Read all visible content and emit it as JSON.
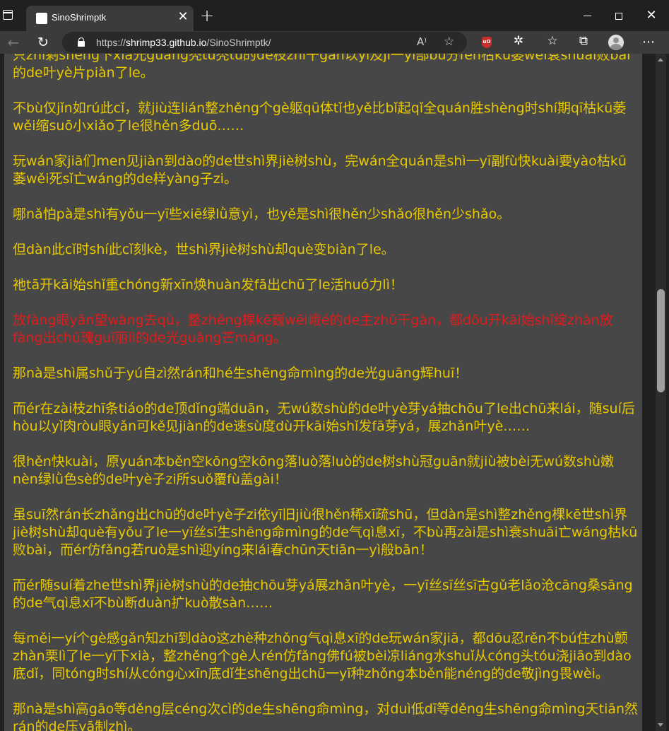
{
  "window": {
    "tab_title": "SinoShrimptk",
    "tab_close": "✕",
    "new_tab": "+",
    "minimize": "",
    "maximize": "",
    "close": "✕"
  },
  "toolbar": {
    "url_prefix": "https://",
    "url_host": "shrimp33.github.io",
    "url_path": "/SinoShrimptk/",
    "back_icon": "←",
    "reload_icon": "↻",
    "read_aloud_icon": "A⁾",
    "add_favorite_icon": "☆",
    "ublock_label": "uO",
    "extensions_icon": "✲",
    "favorites_icon": "☆",
    "collections_icon": "⧉",
    "more_icon": "⋯"
  },
  "article": {
    "paragraphs": [
      "只zhī剩shèng下xià光guāng秃tū秃tū的de枝zhī干gàn以yǐ及jí一yī部bù分fèn枯kū萎wěi衰shuāi败bài的de叶yè片piàn了le。",
      "不bù仅jǐn如rú此cǐ，就jiù连lián整zhěng个gè躯qū体tǐ也yě比bǐ起qǐ全quán胜shèng时shí期qī枯kū萎wěi缩suō小xiǎo了le很hěn多duō……",
      "玩wán家jiā们men见jiàn到dào的de世shì界jiè树shù，完wán全quán是shì一yī副fù快kuài要yào枯kū萎wěi死sǐ亡wáng的de样yàng子zi。",
      "哪nǎ怕pà是shì有yǒu一yī些xiē绿lǜ意yì，也yě是shì很hěn少shǎo很hěn少shǎo。",
      "但dàn此cǐ时shí此cǐ刻kè，世shì界jiè树shù却què变biàn了le。",
      "祂tā开kāi始shǐ重chóng新xīn焕huàn发fā出chū了le活huó力lì！",
      "放fàng眼yǎn望wàng去qù，整zhěng棵kē巍wēi峨é的de主zhǔ干gàn，都dōu开kāi始shǐ绽zhàn放fàng出chū瑰guī丽lì的de光guāng芒máng。",
      "那nà是shì属shǔ于yú自zì然rán和hé生shēng命mìng的de光guāng辉huī！",
      "而ér在zài枝zhī条tiáo的de顶dǐng端duān，无wú数shù的de叶yè芽yá抽chōu了le出chū来lái，随suí后hòu以yǐ肉ròu眼yǎn可kě见jiàn的de速sù度dù开kāi始shǐ发fā芽yá，展zhǎn叶yè……",
      "很hěn快kuài，原yuán本běn空kōng空kōng落luò落luò的de树shù冠guān就jiù被bèi无wú数shù嫩nèn绿lǜ色sè的de叶yè子zi所suǒ覆fù盖gài！",
      "虽suī然rán长zhǎng出chū的de叶yè子zi依yī旧jiù很hěn稀xī疏shū，但dàn是shì整zhěng棵kē世shì界jiè树shù却què有yǒu了le一yī丝sī生shēng命mìng的de气qì息xī，不bù再zài是shì衰shuāi亡wáng枯kū败bài，而ér仿fǎng若ruò是shì迎yíng来lái春chūn天tiān一yì般bān！",
      "而ér随suí着zhe世shì界jiè树shù的de抽chōu芽yá展zhǎn叶yè，一yī丝sī丝sī古gǔ老lǎo沧cāng桑sāng的de气qì息xī不bù断duàn扩kuò散sàn……",
      "每měi一yí个gè感gǎn知zhī到dào这zhè种zhǒng气qì息xī的de玩wán家jiā，都dōu忍rěn不bú住zhù颤zhàn栗lì了le一yī下xià，整zhěng个gè人rén仿fǎng佛fú被bèi凉liáng水shuǐ从cóng头tóu浇jiāo到dào底dǐ，同tóng时shí从cóng心xīn底dǐ生shēng出chū一yī种zhǒng本běn能néng的de敬jìng畏wèi。",
      "那nà是shì高gāo等děng层céng次cì的de生shēng命mìng，对duì低dī等děng生shēng命mìng天tiān然rán的de压yā制zhì。"
    ]
  },
  "colors": {
    "text_default": "#e8c900",
    "text_highlight": "#e11b1b",
    "page_bg": "#474747"
  }
}
